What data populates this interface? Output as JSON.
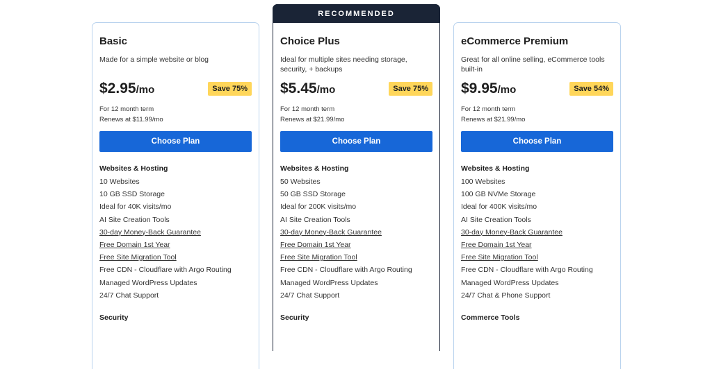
{
  "recommended_label": "RECOMMENDED",
  "plans": [
    {
      "name": "Basic",
      "description": "Made for a simple website or blog",
      "price": "$2.95",
      "per": "/mo",
      "save": "Save 75%",
      "term": "For 12 month term",
      "renews": "Renews at $11.99/mo",
      "cta": "Choose Plan",
      "section_title": "Websites & Hosting",
      "features": [
        "10 Websites",
        "10 GB SSD Storage",
        "Ideal for 40K visits/mo",
        "AI Site Creation Tools",
        "30-day Money-Back Guarantee",
        "Free Domain 1st Year",
        "Free Site Migration Tool",
        "Free CDN - Cloudflare with Argo Routing",
        "Managed WordPress Updates",
        "24/7 Chat Support"
      ],
      "next_section": "Security"
    },
    {
      "name": "Choice Plus",
      "description": "Ideal for multiple sites needing storage, security, + backups",
      "price": "$5.45",
      "per": "/mo",
      "save": "Save 75%",
      "term": "For 12 month term",
      "renews": "Renews at $21.99/mo",
      "cta": "Choose Plan",
      "section_title": "Websites & Hosting",
      "features": [
        "50 Websites",
        "50 GB SSD Storage",
        "Ideal for 200K visits/mo",
        "AI Site Creation Tools",
        "30-day Money-Back Guarantee",
        "Free Domain 1st Year",
        "Free Site Migration Tool",
        "Free CDN - Cloudflare with Argo Routing",
        "Managed WordPress Updates",
        "24/7 Chat Support"
      ],
      "next_section": "Security"
    },
    {
      "name": "eCommerce Premium",
      "description": "Great for all online selling, eCommerce tools built-in",
      "price": "$9.95",
      "per": "/mo",
      "save": "Save 54%",
      "term": "For 12 month term",
      "renews": "Renews at $21.99/mo",
      "cta": "Choose Plan",
      "section_title": "Websites & Hosting",
      "features": [
        "100 Websites",
        "100 GB NVMe Storage",
        "Ideal for 400K visits/mo",
        "AI Site Creation Tools",
        "30-day Money-Back Guarantee",
        "Free Domain 1st Year",
        "Free Site Migration Tool",
        "Free CDN - Cloudflare with Argo Routing",
        "Managed WordPress Updates",
        "24/7 Chat & Phone Support"
      ],
      "next_section": "Commerce Tools"
    }
  ],
  "colors": {
    "cta_blue": "#1767d8",
    "save_badge": "#ffd65a",
    "recommended_banner": "#1a2436",
    "card_border": "#b9d3ee"
  }
}
